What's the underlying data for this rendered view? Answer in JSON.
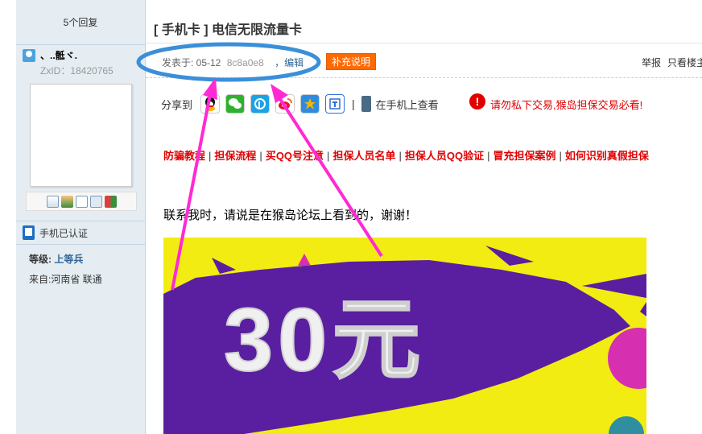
{
  "sidebar": {
    "reply_count": "5个回复",
    "username": "、..骶ヾ.",
    "zxid": "ZxID：18420765",
    "phone_verified": "手机已认证",
    "level_label": "等级:",
    "level_value": "上等兵",
    "from": "来自:河南省 联通",
    "tool_icons": [
      "mail-icon",
      "add-friend-icon",
      "view-icon",
      "profile-icon",
      "blocks-icon"
    ]
  },
  "post": {
    "title": "[ 手机卡 ] 电信无限流量卡",
    "meta_prefix": "发表于: 05-12",
    "meta_code": "8c8a0e8",
    "edit_label": "，编辑",
    "supplement_label": "补充说明",
    "report_label": "举报",
    "only_author_label": "只看楼主"
  },
  "share": {
    "label": "分享到",
    "icons": [
      {
        "name": "qq-icon",
        "color": "#111111"
      },
      {
        "name": "wechat-icon",
        "color": "#2fb12f"
      },
      {
        "name": "pengyou-icon",
        "color": "#1aa3e6"
      },
      {
        "name": "weibo-icon",
        "color": "#f26b1d"
      },
      {
        "name": "qzone-icon",
        "color": "#f5b400"
      },
      {
        "name": "tieba-icon",
        "color": "#2e6fd6"
      }
    ],
    "pipe": "|",
    "mobile_label": "在手机上查看"
  },
  "warning": {
    "icon": "!",
    "text": "请勿私下交易,猴岛担保交易必看!"
  },
  "links": [
    "防骗教程",
    "担保流程",
    "买QQ号注意",
    "担保人员名单",
    "担保人员QQ验证",
    "冒充担保案例",
    "如何识别真假担保"
  ],
  "links_separator": "|",
  "contact_text": "联系我时，请说是在猴岛论坛上看到的，谢谢！",
  "image": {
    "big_text": "30元"
  },
  "colors": {
    "accent_orange": "#ff6a00",
    "warning_red": "#e00000",
    "annotation_blue": "#3b8fd9",
    "annotation_magenta": "#ff2ad4",
    "image_yellow": "#f2ec12",
    "image_purple": "#5a1fa0"
  }
}
